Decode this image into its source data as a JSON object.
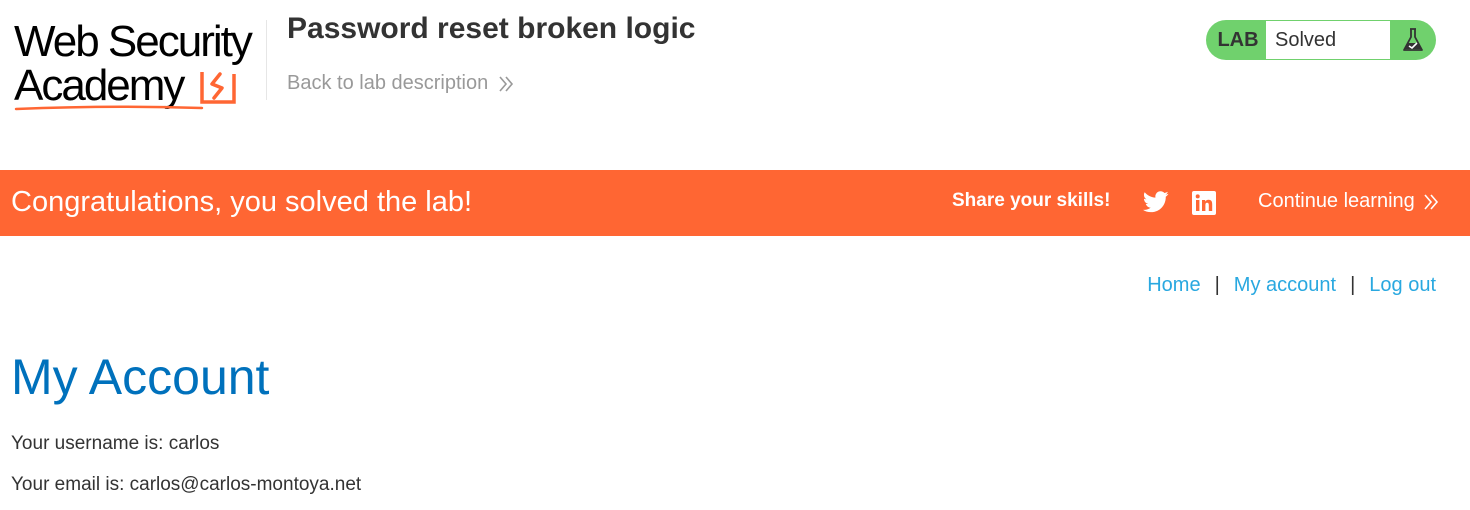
{
  "header": {
    "logo": {
      "line1": "Web Security",
      "line2": "Academy"
    },
    "lab_title": "Password reset broken logic",
    "back_link": "Back to lab description",
    "lab_status": {
      "label": "LAB",
      "status": "Solved"
    }
  },
  "banner": {
    "message": "Congratulations, you solved the lab!",
    "share_text": "Share your skills!",
    "continue_link": "Continue learning"
  },
  "nav": {
    "items": [
      {
        "label": "Home"
      },
      {
        "label": "My account"
      },
      {
        "label": "Log out"
      }
    ],
    "separator": "|"
  },
  "main": {
    "title": "My Account",
    "username_line": "Your username is: carlos",
    "email_line": "Your email is: carlos@carlos-montoya.net"
  },
  "colors": {
    "banner": "#ff6633",
    "lab_badge": "#70d16d",
    "link": "#29a8e0",
    "heading": "#0071bc",
    "logo_accent": "#ff6633"
  },
  "icons": {
    "back_chevron": "double-chevron-right-icon",
    "flask": "flask-icon",
    "twitter": "twitter-icon",
    "linkedin": "linkedin-icon",
    "continue_chevron": "double-chevron-right-icon"
  }
}
